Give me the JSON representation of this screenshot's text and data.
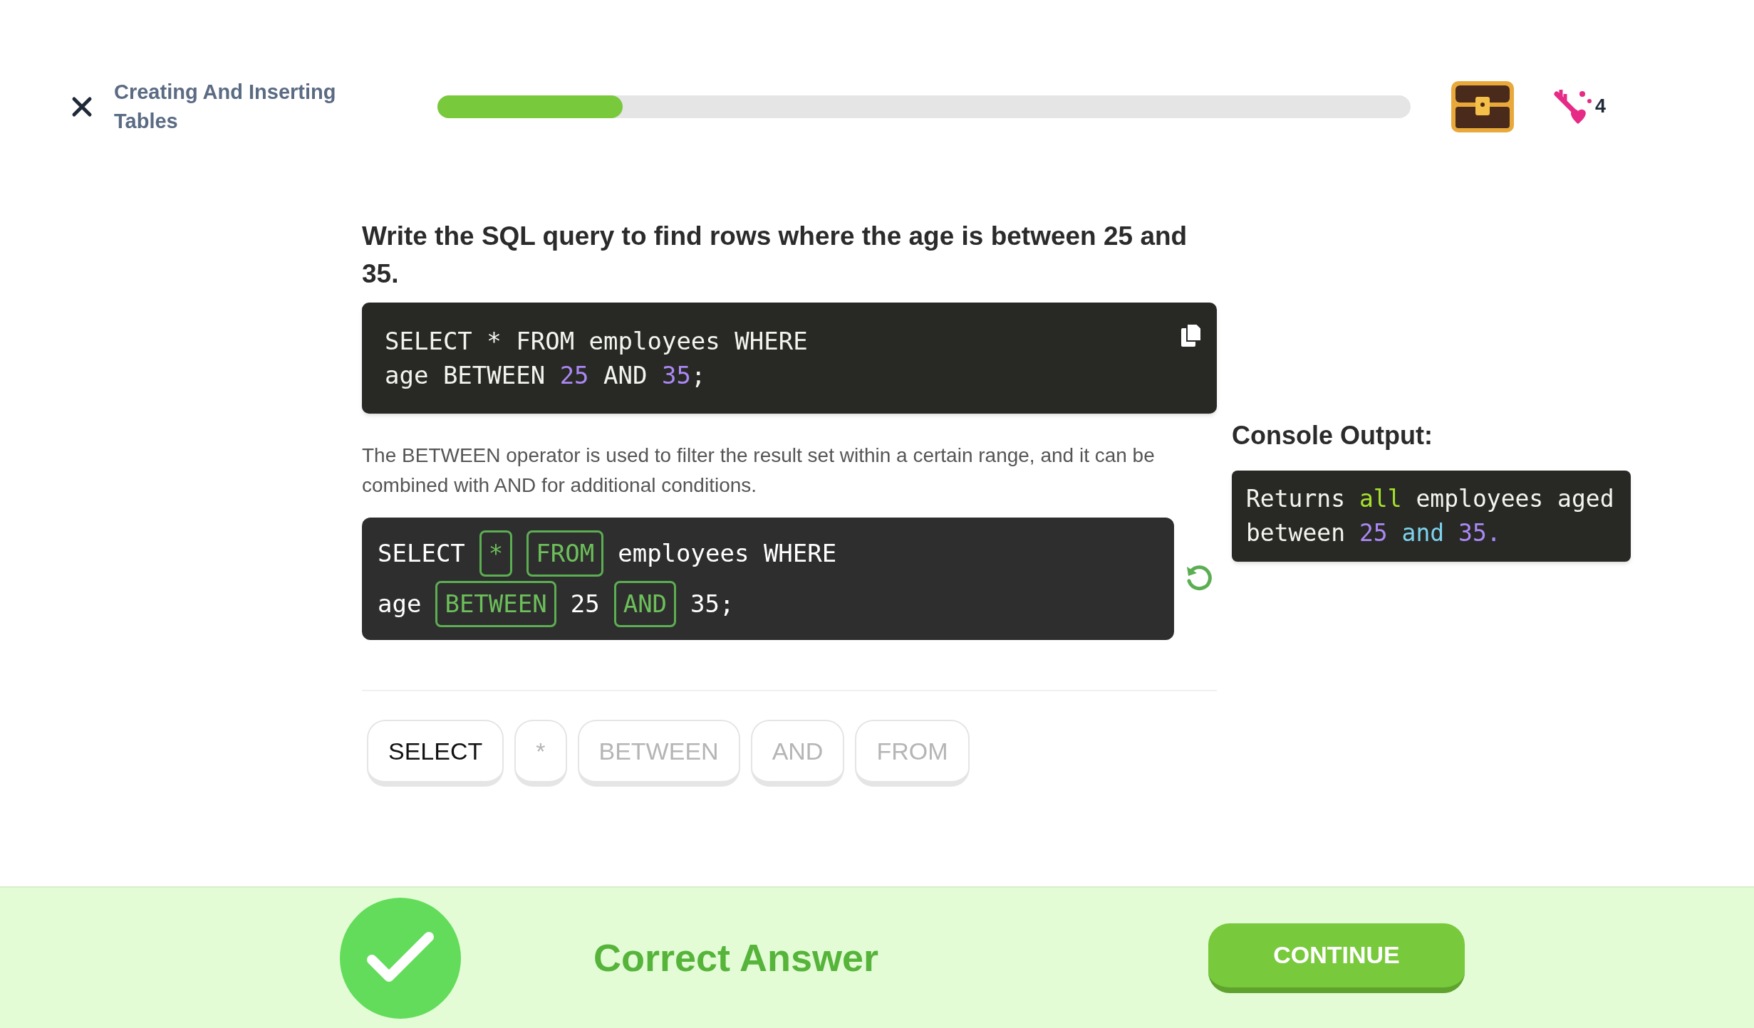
{
  "header": {
    "lesson_title": "Creating And Inserting Tables",
    "progress": {
      "level": 0.19
    },
    "lives": "4"
  },
  "question": "Write the SQL query to find rows where the age is between 25 and 35.",
  "code_block": {
    "lines": [
      [
        {
          "text": "SELECT * FROM employees WHERE",
          "kind": "plain"
        }
      ],
      [
        {
          "text": "age BETWEEN ",
          "kind": "plain"
        },
        {
          "text": "25",
          "kind": "number"
        },
        {
          "text": " AND ",
          "kind": "plain"
        },
        {
          "text": "35",
          "kind": "number"
        },
        {
          "text": ";",
          "kind": "plain"
        }
      ]
    ]
  },
  "description": "The BETWEEN operator is used to filter the result set within a certain range, and it can be combined with AND for additional conditions.",
  "answer": {
    "lines": [
      [
        {
          "text": "SELECT",
          "kind": "plain"
        },
        {
          "text": "*",
          "kind": "slot"
        },
        {
          "text": "FROM",
          "kind": "slot"
        },
        {
          "text": "employees WHERE",
          "kind": "plain"
        }
      ],
      [
        {
          "text": "age",
          "kind": "plain"
        },
        {
          "text": "BETWEEN",
          "kind": "slot"
        },
        {
          "text": "25",
          "kind": "plain"
        },
        {
          "text": "AND",
          "kind": "slot"
        },
        {
          "text": "35;",
          "kind": "plain"
        }
      ]
    ]
  },
  "console": {
    "title": "Console Output:",
    "lines": [
      [
        {
          "text": "Returns ",
          "kind": "plain"
        },
        {
          "text": "all",
          "kind": "keyword"
        },
        {
          "text": " employees aged",
          "kind": "plain"
        }
      ],
      [
        {
          "text": "between ",
          "kind": "plain"
        },
        {
          "text": "25",
          "kind": "number"
        },
        {
          "text": " and ",
          "kind": "operator"
        },
        {
          "text": "35.",
          "kind": "number"
        }
      ]
    ]
  },
  "word_bank": [
    {
      "label": "SELECT",
      "used": false
    },
    {
      "label": "*",
      "used": true
    },
    {
      "label": "BETWEEN",
      "used": true
    },
    {
      "label": "AND",
      "used": true
    },
    {
      "label": "FROM",
      "used": true
    }
  ],
  "feedback": {
    "message": "Correct Answer",
    "correct": true,
    "button": "CONTINUE"
  }
}
